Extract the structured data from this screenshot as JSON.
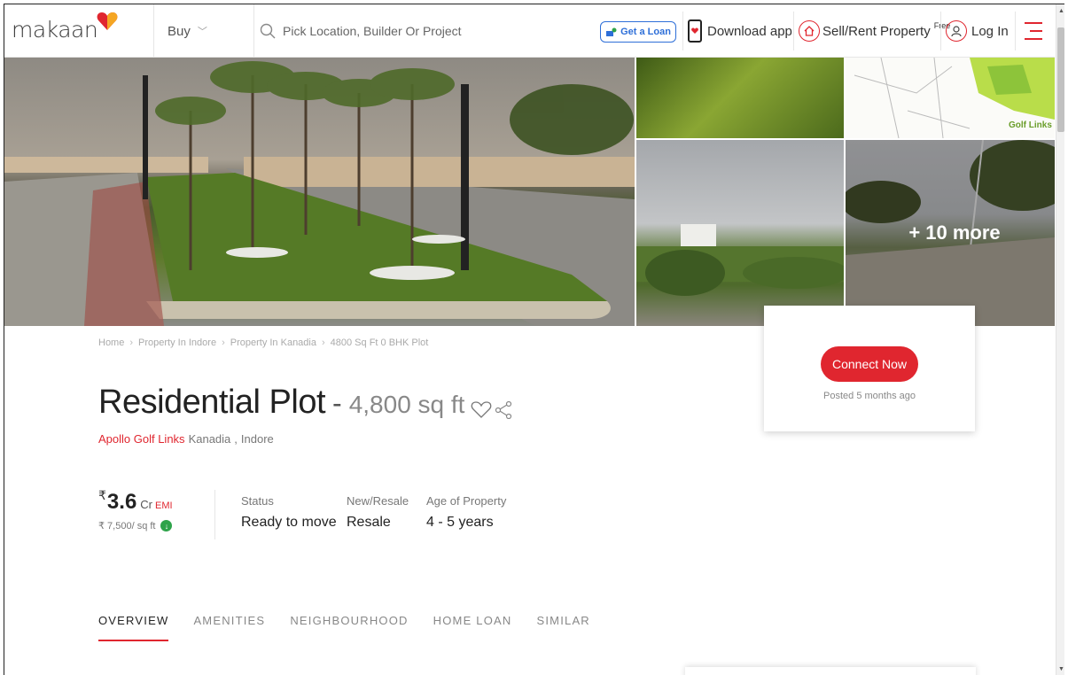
{
  "header": {
    "logo_text": "makaan",
    "buy_label": "Buy",
    "search_placeholder": "Pick Location, Builder Or Project",
    "loan_label": "Get a Loan",
    "download_label": "Download app",
    "sell_label": "Sell/Rent Property",
    "sell_badge": "Free",
    "login_label": "Log In"
  },
  "gallery": {
    "more_label": "+ 10 more",
    "thumb2_watermark": "Golf Links"
  },
  "breadcrumb": [
    "Home",
    "Property In Indore",
    "Property In Kanadia",
    "4800 Sq Ft 0 BHK Plot"
  ],
  "listing": {
    "title": "Residential Plot",
    "dash": "-",
    "area": "4,800 sq ft",
    "project": "Apollo Golf Links",
    "locality": "Kanadia",
    "city": "Indore",
    "rupee_symbol": "₹",
    "price": "3.6",
    "price_unit": "Cr",
    "emi_label": "EMI",
    "price_per_sqft": "₹ 7,500/ sq ft",
    "status_label": "Status",
    "status_value": "Ready to move",
    "resale_label": "New/Resale",
    "resale_value": "Resale",
    "age_label": "Age of Property",
    "age_value": "4 - 5 years"
  },
  "tabs": [
    "OVERVIEW",
    "AMENITIES",
    "NEIGHBOURHOOD",
    "HOME LOAN",
    "SIMILAR"
  ],
  "card": {
    "connect_label": "Connect Now",
    "posted": "Posted 5 months ago"
  },
  "colors": {
    "brand_red": "#e0262f",
    "loan_blue": "#2e6fd8",
    "price_green": "#2ea34a"
  }
}
